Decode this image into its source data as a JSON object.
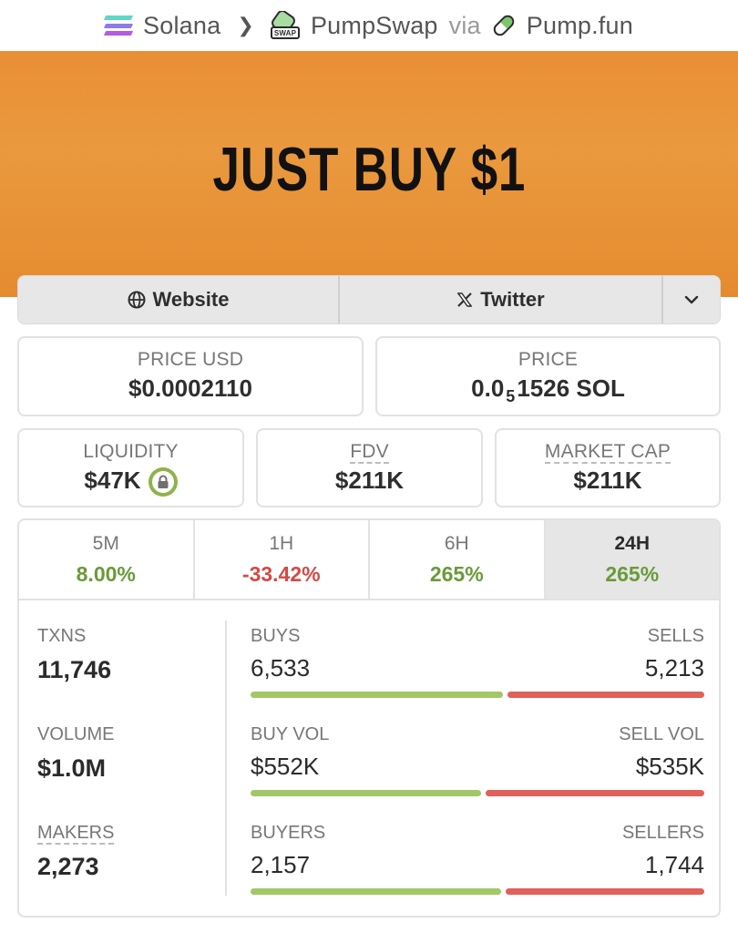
{
  "breadcrumb": {
    "chain": "Solana",
    "dex": "PumpSwap",
    "via": "via",
    "launchpad": "Pump.fun",
    "swap_icon_text": "SWAP"
  },
  "banner": {
    "text": "JUST BUY $1"
  },
  "links": {
    "website": "Website",
    "twitter": "Twitter"
  },
  "price_usd": {
    "label": "PRICE USD",
    "value": "$0.0002110"
  },
  "price_native": {
    "label": "PRICE",
    "prefix": "0.0",
    "zeros_sub": "5",
    "digits": "1526",
    "unit": "SOL"
  },
  "liquidity": {
    "label": "LIQUIDITY",
    "value": "$47K"
  },
  "fdv": {
    "label": "FDV",
    "value": "$211K"
  },
  "market_cap": {
    "label": "MARKET CAP",
    "value": "$211K"
  },
  "periods": [
    {
      "label": "5M",
      "change": "8.00%"
    },
    {
      "label": "1H",
      "change": "-33.42%"
    },
    {
      "label": "6H",
      "change": "265%"
    },
    {
      "label": "24H",
      "change": "265%"
    }
  ],
  "stats": {
    "txns": {
      "label": "TXNS",
      "value": "11,746"
    },
    "volume": {
      "label": "VOLUME",
      "value": "$1.0M"
    },
    "makers": {
      "label": "MAKERS",
      "value": "2,273"
    },
    "buys": {
      "label": "BUYS",
      "value": "6,533",
      "sells_label": "SELLS",
      "sells_value": "5,213",
      "buy_share": 0.556
    },
    "buy_vol": {
      "label": "BUY VOL",
      "value": "$552K",
      "sell_label": "SELL VOL",
      "sell_value": "$535K",
      "buy_share": 0.508
    },
    "buyers": {
      "label": "BUYERS",
      "value": "2,157",
      "sellers_label": "SELLERS",
      "sellers_value": "1,744",
      "buy_share": 0.553
    }
  },
  "colors": {
    "banner": "#e98f35",
    "positive": "#6a9a3a",
    "negative": "#d24a44",
    "buy_bar": "#a3c766",
    "sell_bar": "#e0605a"
  }
}
